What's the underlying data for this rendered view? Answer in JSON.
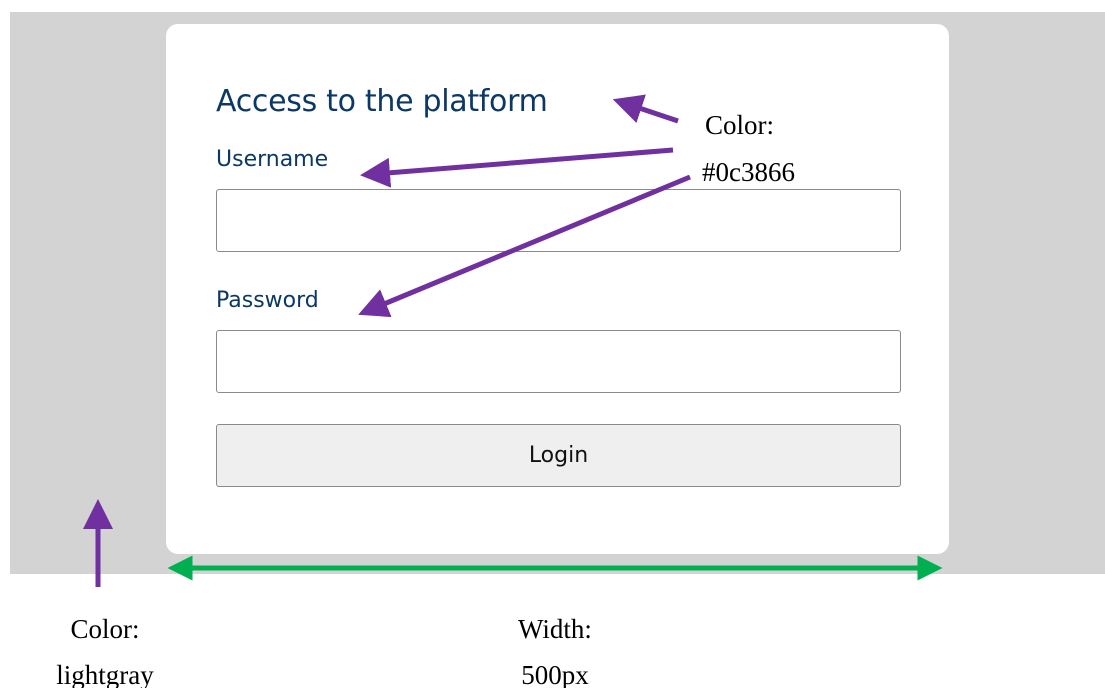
{
  "login_card": {
    "title": "Access to the platform",
    "username_label": "Username",
    "username_value": "",
    "password_label": "Password",
    "password_value": "",
    "login_label": "Login"
  },
  "annotations": {
    "text_color_caption": "Color:",
    "text_color_value": "#0c3866",
    "background_color_caption": "Color:",
    "background_color_value": "lightgray",
    "width_caption": "Width:",
    "width_value": "500px"
  },
  "colors": {
    "text": "#0c3866",
    "page_background": "lightgray",
    "card_background": "#ffffff",
    "button_background": "#efefef",
    "text_arrows": "#7030a0",
    "width_arrow": "#00b050"
  }
}
